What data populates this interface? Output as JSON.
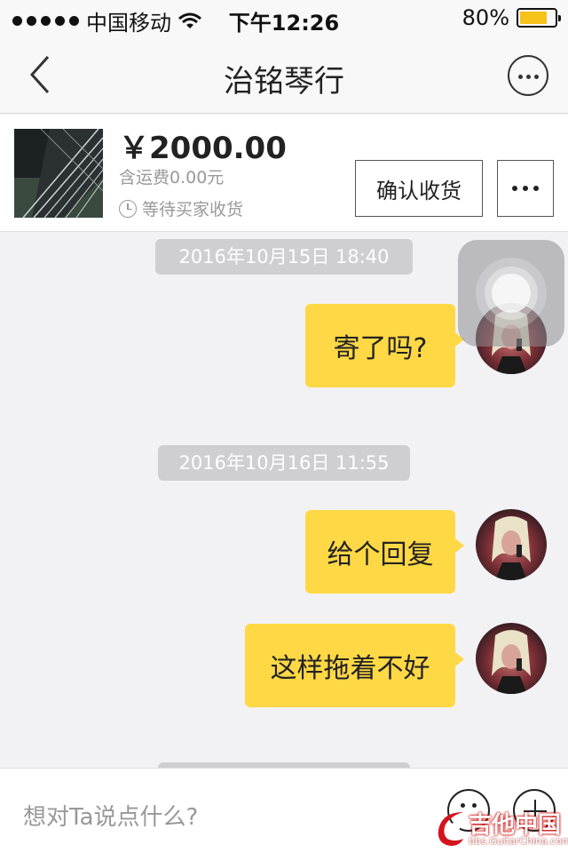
{
  "status_bar": {
    "carrier": "中国移动",
    "time": "下午12:26",
    "battery": "80%",
    "battery_level": 0.8,
    "signal_icon": "signal-dots-icon",
    "wifi_icon": "wifi-icon"
  },
  "nav": {
    "title": "治铭琴行",
    "back_icon": "chevron-left-icon",
    "more_icon": "more-circle-icon"
  },
  "order": {
    "price": "￥2000.00",
    "shipping": "含运费0.00元",
    "status": "等待买家收货",
    "confirm_button": "确认收货",
    "more_icon": "more-dots-icon"
  },
  "messages": [
    {
      "timestamp": "2016年10月15日 18:40"
    },
    {
      "text": "寄了吗?"
    },
    {
      "timestamp": "2016年10月16日 11:55"
    },
    {
      "text": "给个回复"
    },
    {
      "text": "这样拖着不好"
    }
  ],
  "input": {
    "placeholder": "想对Ta说点什么?",
    "emoji_icon": "emoji-smile-icon",
    "add_icon": "plus-circle-icon"
  },
  "watermark": {
    "main": "吉他中国",
    "sub": "bbs.GuitarChina.com"
  },
  "colors": {
    "bubble": "#ffd845",
    "timestamp_bg": "#cfcfd2",
    "chat_bg": "#f2f2f5",
    "battery_fill": "#f7c21a"
  }
}
